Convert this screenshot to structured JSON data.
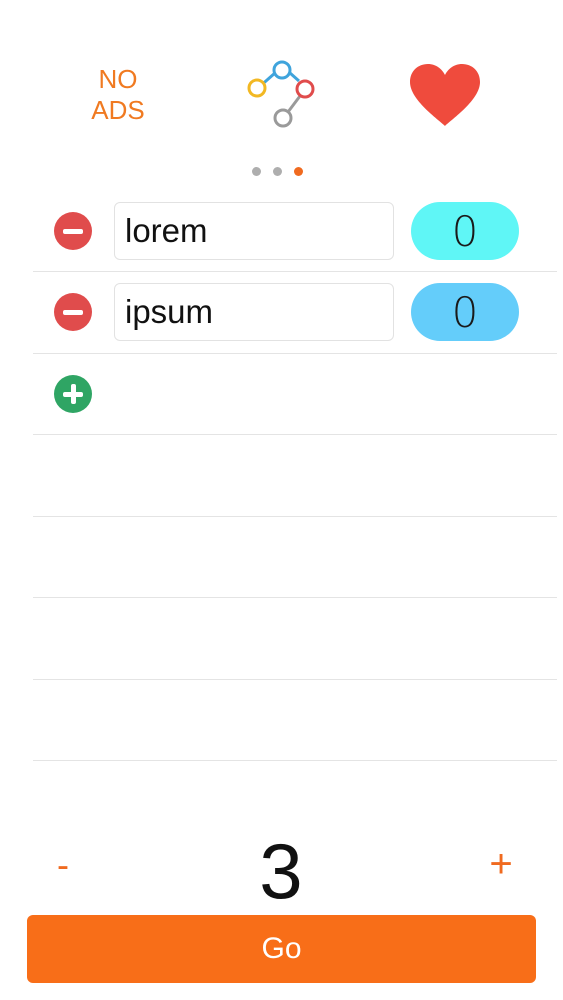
{
  "header": {
    "no_ads_line1": "NO",
    "no_ads_line2": "ADS",
    "share_icon": "share-nodes-icon",
    "favorite_icon": "heart-icon"
  },
  "pager": {
    "count": 3,
    "active_index": 2
  },
  "entries": [
    {
      "name": "lorem",
      "count": "0",
      "pill_color": "#5ff6f6"
    },
    {
      "name": "ipsum",
      "count": "0",
      "pill_color": "#64cdfa"
    }
  ],
  "stepper": {
    "minus_label": "-",
    "value": "3",
    "plus_label": "+"
  },
  "go_button": {
    "label": "Go"
  },
  "colors": {
    "accent_orange": "#f86e18",
    "remove_red": "#e04c4c",
    "add_green": "#2fa564",
    "heart_red": "#ef4b3d"
  }
}
